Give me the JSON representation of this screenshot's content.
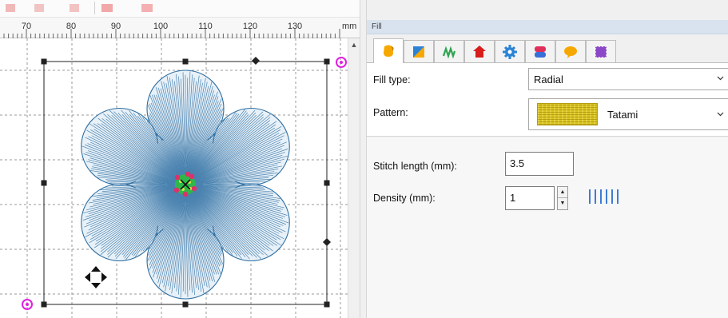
{
  "ruler": {
    "labels": [
      "70",
      "80",
      "90",
      "100",
      "110",
      "120",
      "130"
    ],
    "unit": "mm"
  },
  "panel": {
    "title": "Fill",
    "tabs": [
      {
        "name": "fill-tab",
        "icon": "fill-bucket-icon",
        "active": true
      },
      {
        "name": "gradient-tab",
        "icon": "gradient-fill-icon",
        "active": false
      },
      {
        "name": "effects-tab",
        "icon": "zigzag-effect-icon",
        "active": false
      },
      {
        "name": "applique-tab",
        "icon": "house-shape-icon",
        "active": false
      },
      {
        "name": "settings-tab",
        "icon": "gear-icon",
        "active": false
      },
      {
        "name": "color-tab",
        "icon": "spool-icon",
        "active": false
      },
      {
        "name": "tooltip-tab",
        "icon": "speech-bubble-icon",
        "active": false
      },
      {
        "name": "select-tab",
        "icon": "selection-box-icon",
        "active": false
      }
    ],
    "fill_type": {
      "label": "Fill type:",
      "value": "Radial"
    },
    "pattern": {
      "label": "Pattern:",
      "value": "Tatami"
    },
    "stitch_length": {
      "label": "Stitch length (mm):",
      "value": "3.5"
    },
    "density": {
      "label": "Density (mm):",
      "value": "1"
    }
  },
  "colors": {
    "stitch": "#2e6fa3",
    "selection": "#222222",
    "handle_magenta": "#e020e0",
    "density_lines": "#2a6fd0"
  }
}
